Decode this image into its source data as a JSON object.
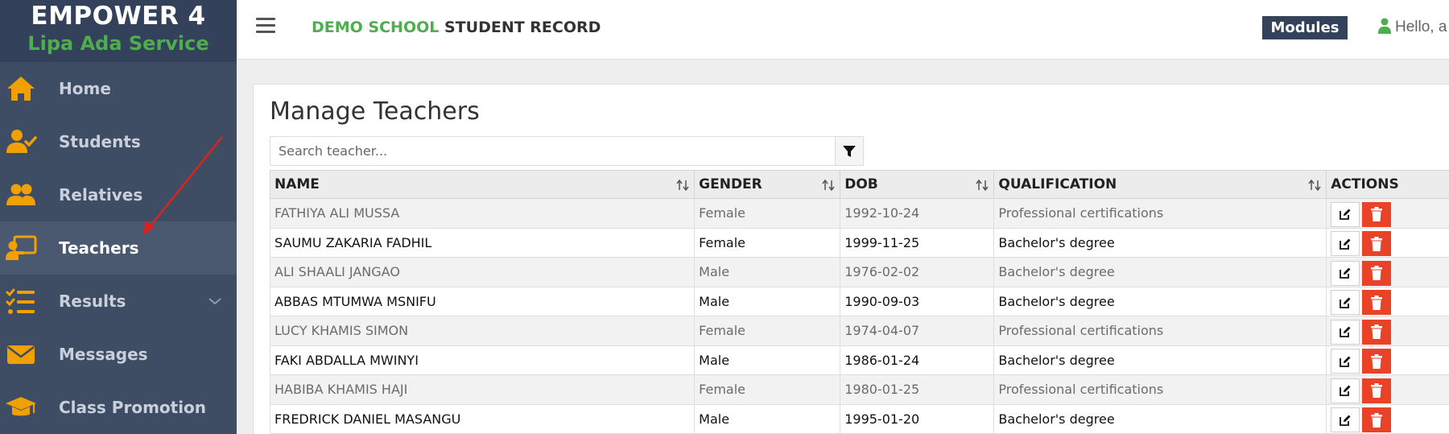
{
  "brand": {
    "title": "EMPOWER 4",
    "subtitle": "Lipa Ada Service"
  },
  "sidebar": {
    "items": [
      {
        "label": "Home",
        "icon": "home-icon"
      },
      {
        "label": "Students",
        "icon": "user-check-icon"
      },
      {
        "label": "Relatives",
        "icon": "users-icon"
      },
      {
        "label": "Teachers",
        "icon": "chalkboard-teacher-icon",
        "active": true
      },
      {
        "label": "Results",
        "icon": "list-check-icon",
        "has_submenu": true
      },
      {
        "label": "Messages",
        "icon": "envelope-icon"
      },
      {
        "label": "Class Promotion",
        "icon": "graduation-cap-icon"
      }
    ]
  },
  "topbar": {
    "school_name": "DEMO SCHOOL",
    "app_name": "STUDENT RECORD",
    "modules_label": "Modules",
    "user_greeting": "Hello, a"
  },
  "page": {
    "heading": "Manage Teachers",
    "search_placeholder": "Search teacher..."
  },
  "table": {
    "columns": [
      "NAME",
      "GENDER",
      "DOB",
      "QUALIFICATION",
      "ACTIONS"
    ],
    "rows": [
      [
        "FATHIYA ALI MUSSA",
        "Female",
        "1992-10-24",
        "Professional certifications"
      ],
      [
        "SAUMU ZAKARIA FADHIL",
        "Female",
        "1999-11-25",
        "Bachelor's degree"
      ],
      [
        "ALI SHAALI JANGAO",
        "Male",
        "1976-02-02",
        "Bachelor's degree"
      ],
      [
        "ABBAS MTUMWA MSNIFU",
        "Male",
        "1990-09-03",
        "Bachelor's degree"
      ],
      [
        "LUCY KHAMIS SIMON",
        "Female",
        "1974-04-07",
        "Professional certifications"
      ],
      [
        "FAKI ABDALLA MWINYI",
        "Male",
        "1986-01-24",
        "Bachelor's degree"
      ],
      [
        "HABIBA KHAMIS HAJI",
        "Female",
        "1980-01-25",
        "Professional certifications"
      ],
      [
        "FREDRICK DANIEL MASANGU",
        "Male",
        "1995-01-20",
        "Bachelor's degree"
      ]
    ]
  },
  "colors": {
    "sidebar_bg": "#3f4d64",
    "icon_orange": "#f0a000",
    "accent_green": "#4cae4c",
    "delete_red": "#ea4226",
    "annotation_arrow": "#e0201c"
  }
}
